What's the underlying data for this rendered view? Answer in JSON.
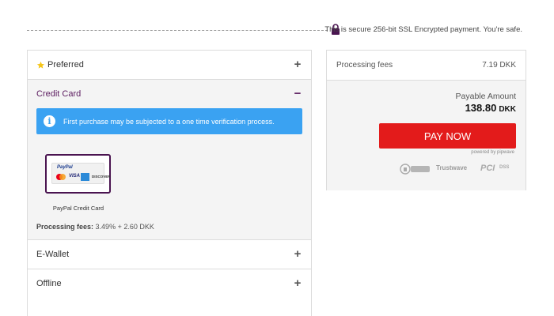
{
  "secure": {
    "text": "This is secure 256-bit SSL Encrypted payment. You're safe.",
    "lock_icon": "padlock-icon"
  },
  "methods": {
    "preferred": {
      "label": "Preferred",
      "icon": "star-icon",
      "toggle": "+"
    },
    "credit_card": {
      "label": "Credit Card",
      "toggle": "−",
      "info": "First purchase may be subjected to a one time verification process.",
      "option_caption": "PayPal Credit Card",
      "logo_text": {
        "paypal": "PayPal",
        "visa": "VISA",
        "discover": "DISCOVER"
      },
      "fees_label": "Processing fees:",
      "fees_value": "3.49% + 2.60 DKK"
    },
    "ewallet": {
      "label": "E-Wallet",
      "toggle": "+"
    },
    "offline": {
      "label": "Offline",
      "toggle": "+"
    }
  },
  "summary": {
    "fee_label": "Processing fees",
    "fee_value": "7.19 DKK",
    "payable_label": "Payable Amount",
    "payable_amount": "138.80",
    "currency": "DKK",
    "pay_button": "PAY NOW",
    "powered_by": "powered by pipwave",
    "badges": {
      "trustwave": "Trustwave",
      "pci": "PCI",
      "dss": "DSS"
    }
  },
  "colors": {
    "accent_purple": "#5b1b5f",
    "info_blue": "#3aa2f2",
    "pay_red": "#e31b1b",
    "star_gold": "#f5c518"
  }
}
